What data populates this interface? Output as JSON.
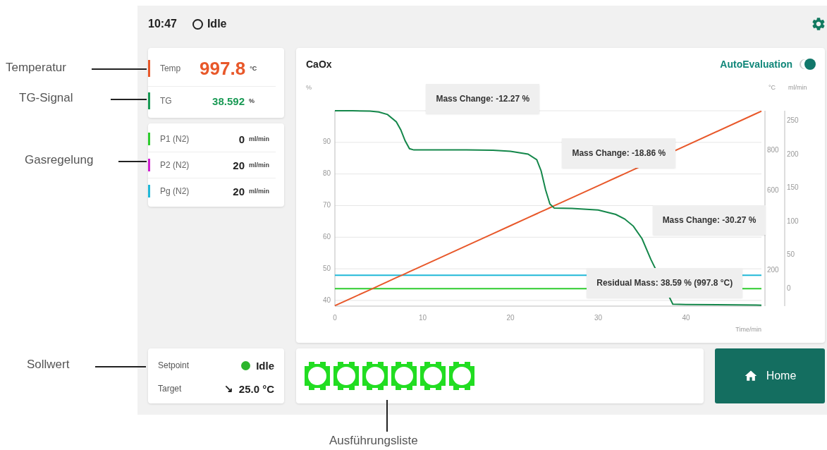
{
  "callouts": [
    {
      "text": "Temperatur"
    },
    {
      "text": "TG-Signal"
    },
    {
      "text": "Gasregelung"
    },
    {
      "text": "Sollwert"
    },
    {
      "text": "Ausführungsliste"
    }
  ],
  "header": {
    "time": "10:47",
    "status": "Idle"
  },
  "readings": [
    {
      "label": "Temp",
      "value": "997.8",
      "unit": "°C",
      "color": "#e8582a",
      "kind": "large"
    },
    {
      "label": "TG",
      "value": "38.592",
      "unit": "%",
      "color": "#1a9a55",
      "kind": "medium"
    }
  ],
  "gases": [
    {
      "label": "P1 (N2)",
      "value": "0",
      "unit": "ml/min",
      "color": "#2ecc2e"
    },
    {
      "label": "P2 (N2)",
      "value": "20",
      "unit": "ml/min",
      "color": "#d020d0"
    },
    {
      "label": "Pg (N2)",
      "value": "20",
      "unit": "ml/min",
      "color": "#20b8d8"
    }
  ],
  "chart": {
    "title": "CaOx",
    "toggle": {
      "label": "AutoEvaluation",
      "on": true
    },
    "chart_data": {
      "type": "line",
      "grid": true,
      "xlabel": "Time/min",
      "ylabel": "%",
      "xlim": [
        0,
        48.6
      ],
      "ylim": [
        38.2,
        100
      ],
      "xticks": [
        0,
        10,
        20,
        30,
        40
      ],
      "yticks": [
        40,
        50,
        60,
        70,
        80,
        90
      ],
      "y2label": "°C",
      "y2lim": [
        23,
        1000
      ],
      "y2ticks": [
        200,
        600,
        800
      ],
      "y3label": "ml/min",
      "y3lim": [
        -26,
        265
      ],
      "y3ticks": [
        0,
        50,
        100,
        150,
        200,
        250
      ],
      "x": [
        0,
        2,
        4,
        5,
        6,
        7,
        7.5,
        8,
        8.5,
        9,
        12,
        15,
        18,
        20,
        22,
        23,
        23.5,
        24,
        24.5,
        25,
        27,
        30,
        32,
        33,
        34,
        35,
        36,
        38.5,
        40,
        48,
        48.6
      ],
      "series": [
        {
          "color": "#20b8d8",
          "axis": "y3",
          "values": [
            20,
            20,
            20,
            20,
            20,
            20,
            20,
            20,
            20,
            20,
            20,
            20,
            20,
            20,
            20,
            20,
            20,
            20,
            20,
            20,
            20,
            null,
            null,
            null,
            null,
            null,
            null,
            null,
            null,
            20,
            20
          ]
        },
        {
          "color": "#2ecc2e",
          "axis": "y3",
          "values": [
            0,
            0,
            0,
            0,
            0,
            0,
            0,
            0,
            0,
            0,
            0,
            0,
            0,
            0,
            0,
            0,
            0,
            0,
            0,
            0,
            0,
            null,
            null,
            null,
            null,
            null,
            null,
            null,
            null,
            0,
            0
          ]
        },
        {
          "color": "#e8582a",
          "axis": "y2",
          "values": [
            25,
            65,
            105,
            125,
            145,
            165,
            175,
            185,
            195,
            205,
            265,
            325,
            385,
            425,
            465,
            485,
            495,
            505,
            515,
            525,
            565,
            625,
            665,
            685,
            null,
            null,
            null,
            null,
            null,
            986,
            998
          ]
        },
        {
          "color": "#14874a",
          "values": [
            100,
            100,
            99.9,
            99.6,
            98.8,
            96.5,
            94,
            90.5,
            88,
            87.6,
            87.6,
            87.6,
            87.5,
            87.2,
            86.3,
            84.5,
            81,
            75,
            70.5,
            69.2,
            69.1,
            68.6,
            67.2,
            65.8,
            63.5,
            59.5,
            53,
            38.8,
            38.7,
            38.55,
            38.5
          ]
        }
      ],
      "annotations": [
        "Mass Change: -12.27 %",
        "Mass Change: -18.86 %",
        "Mass Change: -30.27 %",
        "Residual Mass: 38.59 % (997.8 °C)"
      ]
    }
  },
  "setpoint": {
    "label": "Setpoint",
    "status": "Idle",
    "target_label": "Target",
    "arrow": "↘",
    "target": "25.0 °C"
  },
  "execution_list": [
    {
      "color": "#22dd22"
    },
    {
      "color": "#22dd22"
    },
    {
      "color": "#22dd22"
    },
    {
      "color": "#22dd22"
    },
    {
      "color": "#22dd22"
    },
    {
      "color": "#22dd22"
    }
  ],
  "home_button": {
    "label": "Home"
  }
}
